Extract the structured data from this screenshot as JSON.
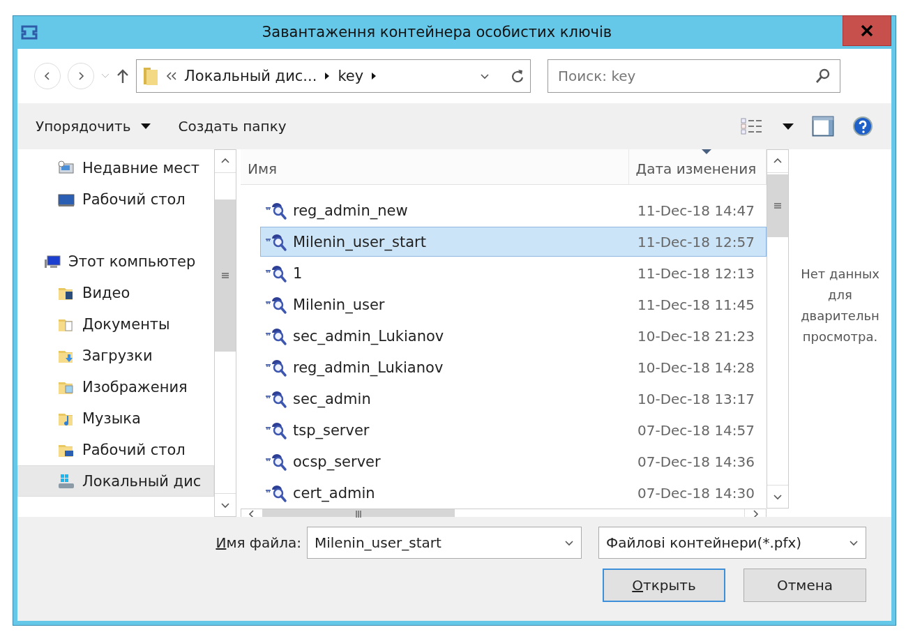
{
  "window": {
    "title": "Завантаження контейнера особистих ключів"
  },
  "address": {
    "segments": [
      "Локальный дис...",
      "key"
    ]
  },
  "search": {
    "placeholder": "Поиск: key"
  },
  "toolbar": {
    "organize": "Упорядочить",
    "new_folder": "Создать папку"
  },
  "favorites": [
    {
      "label": "Недавние мест",
      "kind": "recent",
      "selected": false
    },
    {
      "label": "Рабочий стол",
      "kind": "desktop",
      "selected": false
    }
  ],
  "computer": {
    "label": "Этот компьютер",
    "selected": false,
    "children": [
      {
        "label": "Видео",
        "kind": "video",
        "selected": false
      },
      {
        "label": "Документы",
        "kind": "docs",
        "selected": false
      },
      {
        "label": "Загрузки",
        "kind": "downloads",
        "selected": false
      },
      {
        "label": "Изображения",
        "kind": "pictures",
        "selected": false
      },
      {
        "label": "Музыка",
        "kind": "music",
        "selected": false
      },
      {
        "label": "Рабочий стол",
        "kind": "desktopfolder",
        "selected": false
      },
      {
        "label": "Локальный дис",
        "kind": "disk",
        "selected": true
      }
    ]
  },
  "columns": [
    {
      "label": "Имя",
      "sorted": false
    },
    {
      "label": "Дата изменения",
      "sorted": true
    }
  ],
  "files": [
    {
      "name": "reg_admin_new",
      "date": "11-Dec-18 14:47",
      "selected": false
    },
    {
      "name": "Milenin_user_start",
      "date": "11-Dec-18 12:57",
      "selected": true
    },
    {
      "name": "1",
      "date": "11-Dec-18 12:13",
      "selected": false
    },
    {
      "name": "Milenin_user",
      "date": "11-Dec-18 11:45",
      "selected": false
    },
    {
      "name": "sec_admin_Lukianov",
      "date": "10-Dec-18 21:23",
      "selected": false
    },
    {
      "name": "reg_admin_Lukianov",
      "date": "10-Dec-18 14:28",
      "selected": false
    },
    {
      "name": "sec_admin",
      "date": "10-Dec-18 13:17",
      "selected": false
    },
    {
      "name": "tsp_server",
      "date": "07-Dec-18 14:57",
      "selected": false
    },
    {
      "name": "ocsp_server",
      "date": "07-Dec-18 14:36",
      "selected": false
    },
    {
      "name": "cert_admin",
      "date": "07-Dec-18 14:30",
      "selected": false
    }
  ],
  "preview": {
    "lines": [
      "Нет данных",
      "для",
      "дварительн",
      "просмотра."
    ]
  },
  "filename": {
    "label": "Имя файла:",
    "label_mnemonic": true,
    "value": "Milenin_user_start"
  },
  "filetype": {
    "value": "Файлові контейнери(*.pfx)"
  },
  "buttons": [
    {
      "label": "Открыть",
      "mnemonic": true,
      "default": true
    },
    {
      "label": "Отмена",
      "mnemonic": false,
      "default": false
    }
  ]
}
